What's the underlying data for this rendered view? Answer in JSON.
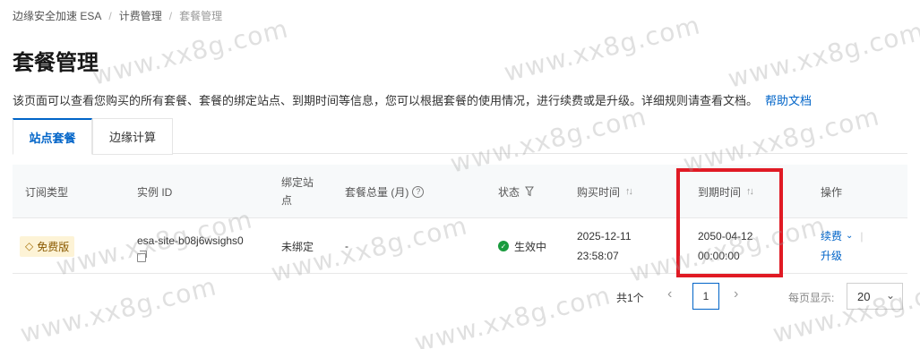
{
  "breadcrumb": {
    "items": [
      "边缘安全加速 ESA",
      "计费管理",
      "套餐管理"
    ],
    "separator": "/"
  },
  "page": {
    "title": "套餐管理",
    "description": "该页面可以查看您购买的所有套餐、套餐的绑定站点、到期时间等信息，您可以根据套餐的使用情况，进行续费或是升级。详细规则请查看文档。",
    "help_link": "帮助文档"
  },
  "tabs": [
    {
      "label": "站点套餐",
      "active": true
    },
    {
      "label": "边缘计算",
      "active": false
    }
  ],
  "table": {
    "headers": {
      "sub_type": "订阅类型",
      "instance_id": "实例 ID",
      "bound_site_line1": "绑定站",
      "bound_site_line2": "点",
      "total": "套餐总量 (月)",
      "status": "状态",
      "purchase_time": "购买时间",
      "expire_time": "到期时间",
      "actions": "操作"
    },
    "rows": [
      {
        "sub_type": "免费版",
        "instance_id": "esa-site-b08j6wsighs0",
        "bound_site": "未绑定",
        "total": "-",
        "status": "生效中",
        "purchase_date": "2025-12-11",
        "purchase_clock": "23:58:07",
        "expire_date": "2050-04-12",
        "expire_clock": "00:00:00",
        "action_renew": "续费",
        "action_upgrade": "升级"
      }
    ]
  },
  "pagination": {
    "total_label": "共1个",
    "current_page": "1",
    "per_page_label": "每页显示:",
    "per_page_value": "20"
  },
  "watermark": "www.xx8g.com",
  "colors": {
    "accent": "#0064c8",
    "highlight": "#e01a24",
    "status_ok": "#1a9b3e",
    "badge_bg": "#fdf3d6"
  }
}
